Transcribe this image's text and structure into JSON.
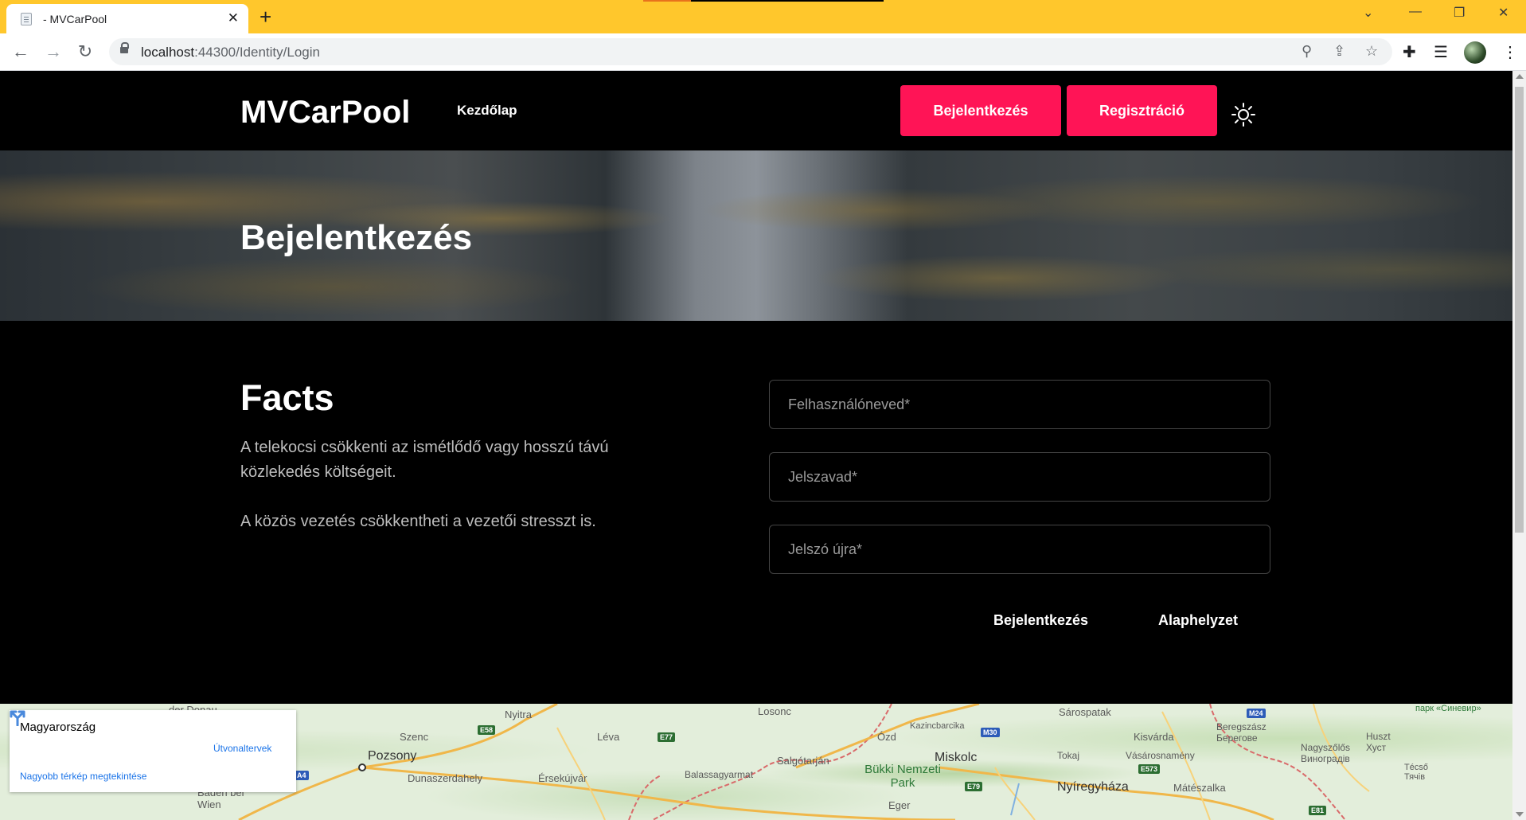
{
  "browser": {
    "tab_title": "- MVCarPool",
    "url_host": "localhost",
    "url_path": ":44300/Identity/Login"
  },
  "header": {
    "brand": "MVCarPool",
    "nav_home": "Kezdőlap",
    "login_button": "Bejelentkezés",
    "register_button": "Regisztráció",
    "accent_color": "#ff1456"
  },
  "hero": {
    "title": "Bejelentkezés"
  },
  "facts": {
    "title": "Facts",
    "text_1": "A telekocsi csökkenti az ismétlődő vagy hosszú távú közlekedés költségeit.",
    "text_2": "A közös vezetés csökkentheti a vezetői stresszt is."
  },
  "form": {
    "username_placeholder": "Felhasználóneved*",
    "password_placeholder": "Jelszavad*",
    "password_repeat_placeholder": "Jelszó újra*",
    "submit_label": "Bejelentkezés",
    "reset_label": "Alaphelyzet"
  },
  "map": {
    "card_title": "Magyarország",
    "directions_label": "Útvonaltervek",
    "larger_map_link": "Nagyobb térkép megtekintése",
    "places": [
      "der Donau",
      "Nyitra",
      "Losonc",
      "Sárospatak",
      "Szenc",
      "Léva",
      "Ózd",
      "Kazincbarcika",
      "Kisvárda",
      "Beregszász Берегове",
      "Huszt Хуст",
      "Pozsony",
      "Salgótarján",
      "Miskolc",
      "Tokaj",
      "Vásárosnamény",
      "Nagyszőlős Виноградів",
      "Dunaszerdahely",
      "Érsekújvár",
      "Balassagyarmat",
      "Bükki Nemzeti Park",
      "Nyíregyháza",
      "Mátészalka",
      "Técső Тячів",
      "Baden bei Wien",
      "Eger",
      "парк «Синевир»"
    ],
    "road_shields": [
      "E58",
      "E77",
      "M30",
      "M24",
      "A4",
      "E573",
      "E79",
      "E81"
    ]
  }
}
